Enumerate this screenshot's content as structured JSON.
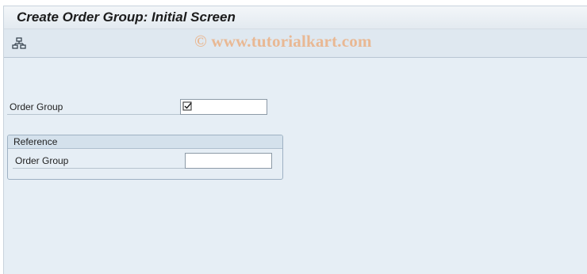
{
  "window": {
    "title": "Create Order Group: Initial Screen"
  },
  "toolbar": {
    "hierarchy_icon": "hierarchy-structure-icon"
  },
  "watermark": {
    "text": "© www.tutorialkart.com"
  },
  "form": {
    "order_group_label": "Order Group",
    "order_group_value": "",
    "order_group_required_icon": "required-check-icon"
  },
  "reference": {
    "title": "Reference",
    "order_group_label": "Order Group",
    "order_group_value": ""
  }
}
